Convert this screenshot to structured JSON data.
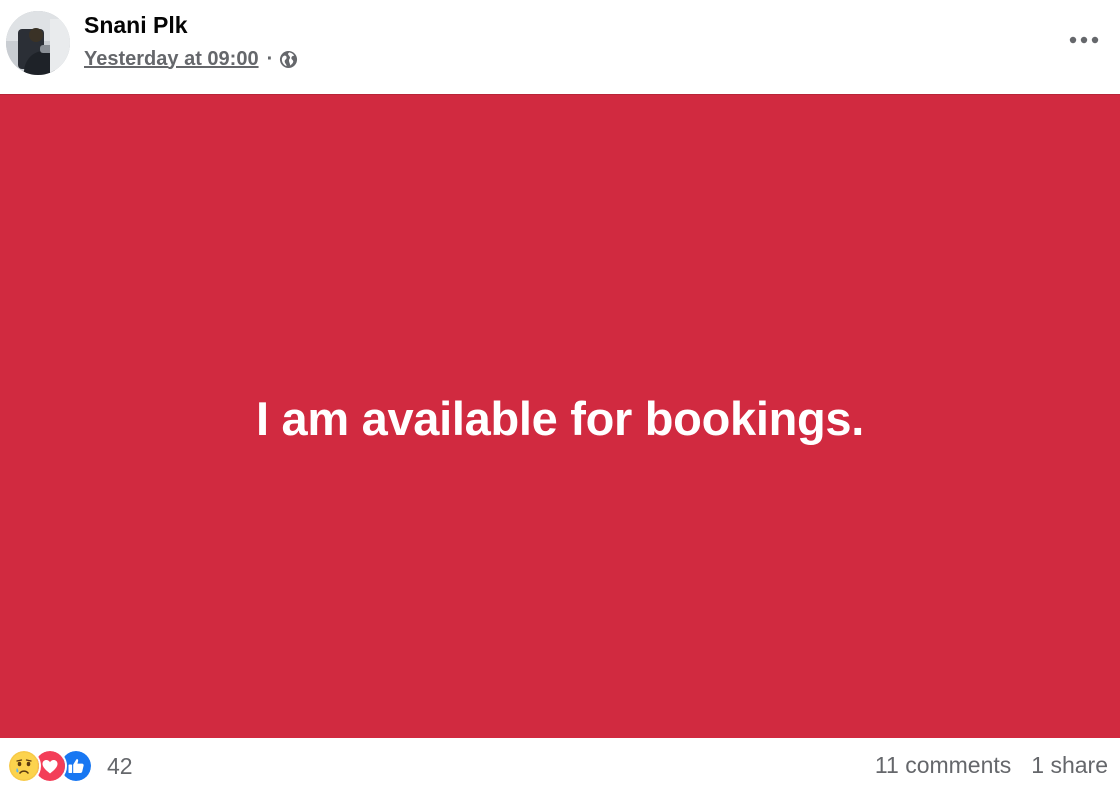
{
  "post": {
    "author": {
      "name": "Snani Plk",
      "avatar_icon": "profile-photo"
    },
    "timestamp": "Yesterday at 09:00",
    "separator": "·",
    "audience_icon": "globe-icon",
    "menu_icon": "more-options-icon",
    "banner": {
      "text": "I am available for bookings.",
      "background_color": "#d12a40",
      "text_color": "#ffffff"
    },
    "reactions": {
      "types": [
        "sad",
        "love",
        "like"
      ],
      "count": "42"
    },
    "comments_label": "11 comments",
    "shares_label": "1 share"
  }
}
